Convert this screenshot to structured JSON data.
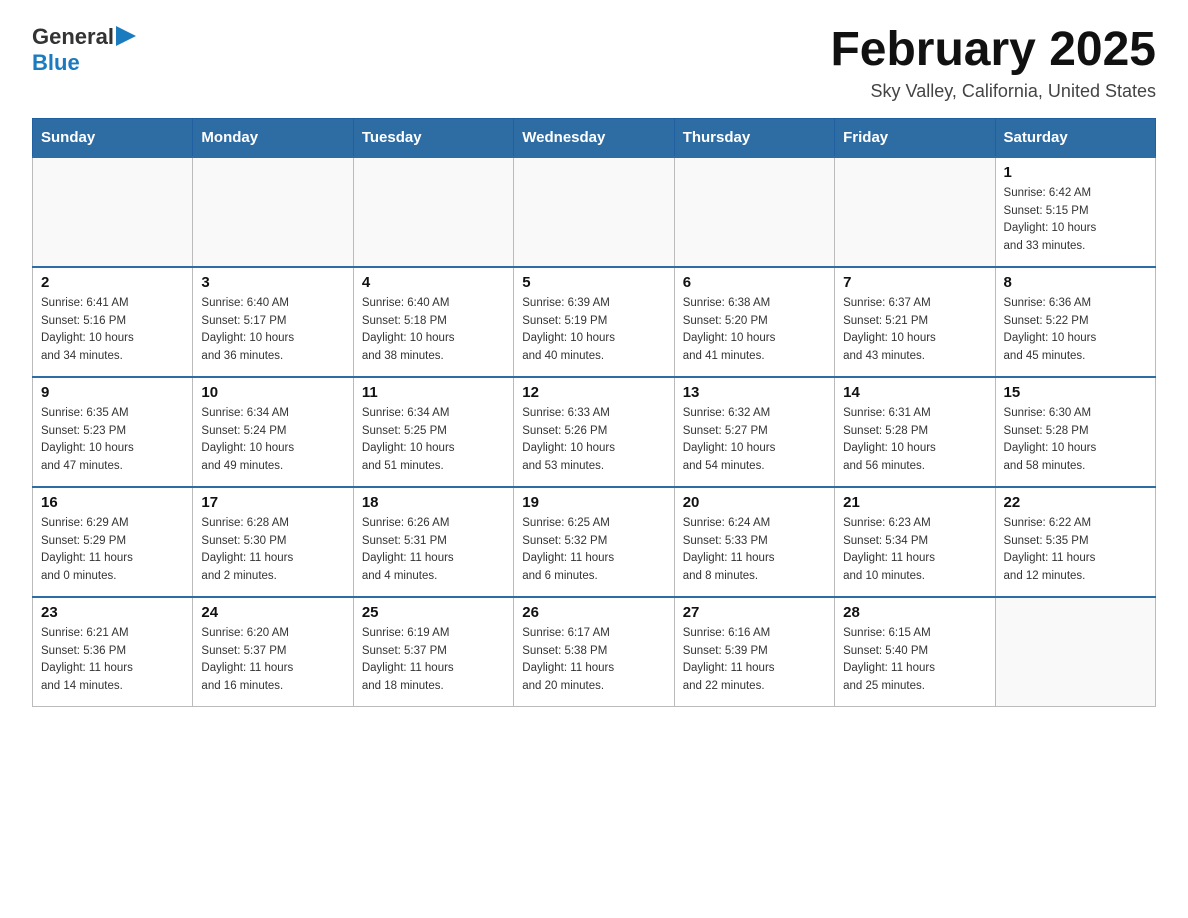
{
  "logo": {
    "general": "General",
    "blue": "Blue"
  },
  "title": "February 2025",
  "subtitle": "Sky Valley, California, United States",
  "weekdays": [
    "Sunday",
    "Monday",
    "Tuesday",
    "Wednesday",
    "Thursday",
    "Friday",
    "Saturday"
  ],
  "weeks": [
    [
      {
        "day": "",
        "info": ""
      },
      {
        "day": "",
        "info": ""
      },
      {
        "day": "",
        "info": ""
      },
      {
        "day": "",
        "info": ""
      },
      {
        "day": "",
        "info": ""
      },
      {
        "day": "",
        "info": ""
      },
      {
        "day": "1",
        "info": "Sunrise: 6:42 AM\nSunset: 5:15 PM\nDaylight: 10 hours\nand 33 minutes."
      }
    ],
    [
      {
        "day": "2",
        "info": "Sunrise: 6:41 AM\nSunset: 5:16 PM\nDaylight: 10 hours\nand 34 minutes."
      },
      {
        "day": "3",
        "info": "Sunrise: 6:40 AM\nSunset: 5:17 PM\nDaylight: 10 hours\nand 36 minutes."
      },
      {
        "day": "4",
        "info": "Sunrise: 6:40 AM\nSunset: 5:18 PM\nDaylight: 10 hours\nand 38 minutes."
      },
      {
        "day": "5",
        "info": "Sunrise: 6:39 AM\nSunset: 5:19 PM\nDaylight: 10 hours\nand 40 minutes."
      },
      {
        "day": "6",
        "info": "Sunrise: 6:38 AM\nSunset: 5:20 PM\nDaylight: 10 hours\nand 41 minutes."
      },
      {
        "day": "7",
        "info": "Sunrise: 6:37 AM\nSunset: 5:21 PM\nDaylight: 10 hours\nand 43 minutes."
      },
      {
        "day": "8",
        "info": "Sunrise: 6:36 AM\nSunset: 5:22 PM\nDaylight: 10 hours\nand 45 minutes."
      }
    ],
    [
      {
        "day": "9",
        "info": "Sunrise: 6:35 AM\nSunset: 5:23 PM\nDaylight: 10 hours\nand 47 minutes."
      },
      {
        "day": "10",
        "info": "Sunrise: 6:34 AM\nSunset: 5:24 PM\nDaylight: 10 hours\nand 49 minutes."
      },
      {
        "day": "11",
        "info": "Sunrise: 6:34 AM\nSunset: 5:25 PM\nDaylight: 10 hours\nand 51 minutes."
      },
      {
        "day": "12",
        "info": "Sunrise: 6:33 AM\nSunset: 5:26 PM\nDaylight: 10 hours\nand 53 minutes."
      },
      {
        "day": "13",
        "info": "Sunrise: 6:32 AM\nSunset: 5:27 PM\nDaylight: 10 hours\nand 54 minutes."
      },
      {
        "day": "14",
        "info": "Sunrise: 6:31 AM\nSunset: 5:28 PM\nDaylight: 10 hours\nand 56 minutes."
      },
      {
        "day": "15",
        "info": "Sunrise: 6:30 AM\nSunset: 5:28 PM\nDaylight: 10 hours\nand 58 minutes."
      }
    ],
    [
      {
        "day": "16",
        "info": "Sunrise: 6:29 AM\nSunset: 5:29 PM\nDaylight: 11 hours\nand 0 minutes."
      },
      {
        "day": "17",
        "info": "Sunrise: 6:28 AM\nSunset: 5:30 PM\nDaylight: 11 hours\nand 2 minutes."
      },
      {
        "day": "18",
        "info": "Sunrise: 6:26 AM\nSunset: 5:31 PM\nDaylight: 11 hours\nand 4 minutes."
      },
      {
        "day": "19",
        "info": "Sunrise: 6:25 AM\nSunset: 5:32 PM\nDaylight: 11 hours\nand 6 minutes."
      },
      {
        "day": "20",
        "info": "Sunrise: 6:24 AM\nSunset: 5:33 PM\nDaylight: 11 hours\nand 8 minutes."
      },
      {
        "day": "21",
        "info": "Sunrise: 6:23 AM\nSunset: 5:34 PM\nDaylight: 11 hours\nand 10 minutes."
      },
      {
        "day": "22",
        "info": "Sunrise: 6:22 AM\nSunset: 5:35 PM\nDaylight: 11 hours\nand 12 minutes."
      }
    ],
    [
      {
        "day": "23",
        "info": "Sunrise: 6:21 AM\nSunset: 5:36 PM\nDaylight: 11 hours\nand 14 minutes."
      },
      {
        "day": "24",
        "info": "Sunrise: 6:20 AM\nSunset: 5:37 PM\nDaylight: 11 hours\nand 16 minutes."
      },
      {
        "day": "25",
        "info": "Sunrise: 6:19 AM\nSunset: 5:37 PM\nDaylight: 11 hours\nand 18 minutes."
      },
      {
        "day": "26",
        "info": "Sunrise: 6:17 AM\nSunset: 5:38 PM\nDaylight: 11 hours\nand 20 minutes."
      },
      {
        "day": "27",
        "info": "Sunrise: 6:16 AM\nSunset: 5:39 PM\nDaylight: 11 hours\nand 22 minutes."
      },
      {
        "day": "28",
        "info": "Sunrise: 6:15 AM\nSunset: 5:40 PM\nDaylight: 11 hours\nand 25 minutes."
      },
      {
        "day": "",
        "info": ""
      }
    ]
  ]
}
